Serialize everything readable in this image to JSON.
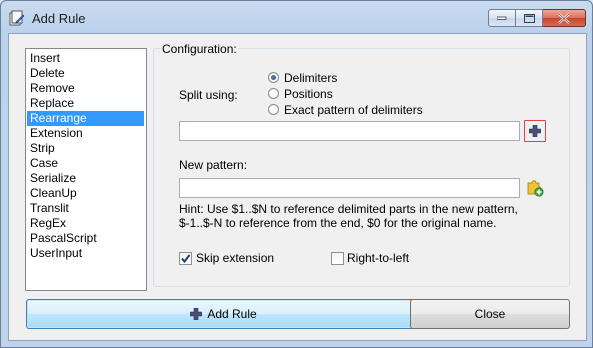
{
  "window": {
    "title": "Add Rule"
  },
  "rules": {
    "items": [
      "Insert",
      "Delete",
      "Remove",
      "Replace",
      "Rearrange",
      "Extension",
      "Strip",
      "Case",
      "Serialize",
      "CleanUp",
      "Translit",
      "RegEx",
      "PascalScript",
      "UserInput"
    ],
    "selected": "Rearrange"
  },
  "config": {
    "group_label": "Configuration:",
    "split_label": "Split using:",
    "options": [
      "Delimiters",
      "Positions",
      "Exact pattern of delimiters"
    ],
    "selected_option": "Delimiters",
    "split_value": "",
    "pattern_label": "New pattern:",
    "pattern_value": "",
    "hint_line1": "Hint: Use $1..$N to reference delimited parts in the new pattern,",
    "hint_line2": "$-1..$-N to reference from the end, $0 for the original name.",
    "skip_extension": {
      "label": "Skip extension",
      "checked": true
    },
    "right_to_left": {
      "label": "Right-to-left",
      "checked": false
    }
  },
  "buttons": {
    "add_rule": "Add Rule",
    "close": "Close"
  },
  "icons": {
    "app": "rename-app-icon",
    "add_delimiter": "plus-icon",
    "insert_meta": "puzzle-add-icon"
  },
  "colors": {
    "selection": "#3399ff",
    "focus": "#e04343"
  }
}
